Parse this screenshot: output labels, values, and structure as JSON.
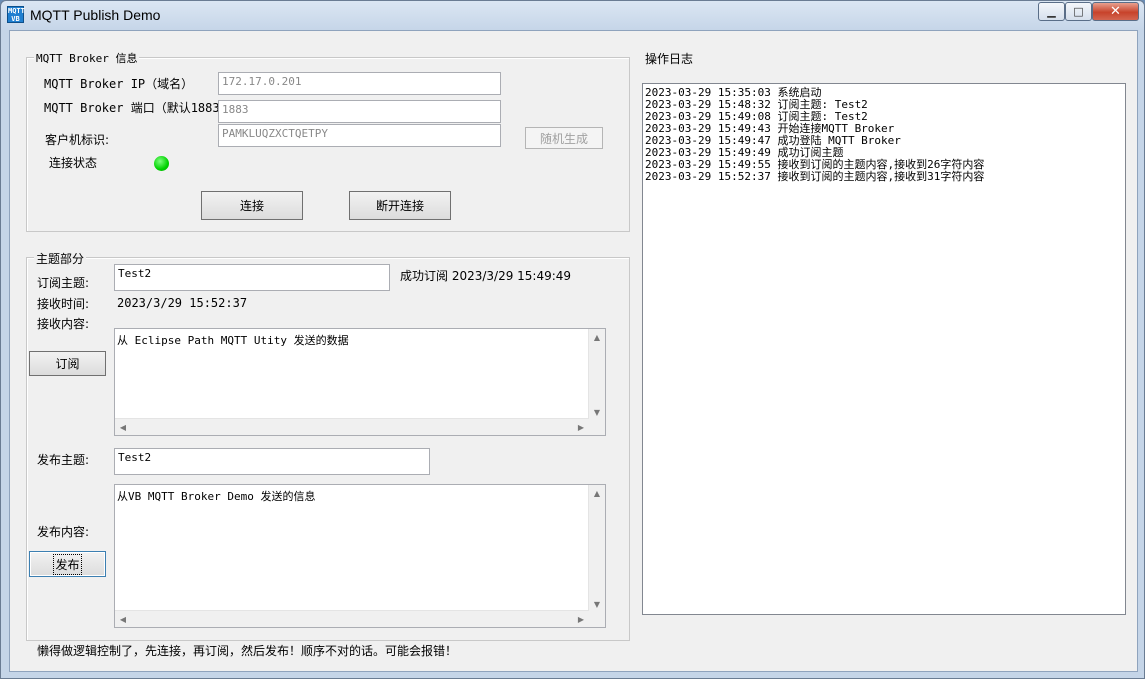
{
  "window": {
    "title": "MQTT Publish Demo",
    "icon_text": "MQTT VB",
    "min_icon": "minimize-icon",
    "max_icon": "maximize-icon",
    "close_icon": "close-icon"
  },
  "broker": {
    "group_label": "MQTT Broker 信息",
    "ip_label": "MQTT Broker IP（域名）",
    "ip_value": "172.17.0.201",
    "port_label": "MQTT Broker 端口（默认1883）",
    "port_value": "1883",
    "client_id_label": "客户机标识:",
    "client_id_value": "PAMKLUQZXCTQETPY",
    "random_button": "随机生成",
    "status_label": "连接状态",
    "status_color": "#00d200",
    "connect_button": "连接",
    "disconnect_button": "断开连接"
  },
  "topic": {
    "group_label": "主题部分",
    "subscribe_topic_label": "订阅主题:",
    "subscribe_topic_value": "Test2",
    "subscribe_status": "成功订阅 2023/3/29 15:49:49",
    "receive_time_label": "接收时间:",
    "receive_time_value": "2023/3/29 15:52:37",
    "receive_content_label": "接收内容:",
    "receive_content_value": "从 Eclipse Path MQTT Utity 发送的数据",
    "subscribe_button": "订阅",
    "publish_topic_label": "发布主题:",
    "publish_topic_value": "Test2",
    "publish_content_label": "发布内容:",
    "publish_content_value": "从VB MQTT Broker Demo 发送的信息",
    "publish_button": "发布"
  },
  "hint": "懒得做逻辑控制了，先连接，再订阅，然后发布！顺序不对的话。可能会报错！",
  "log": {
    "title": "操作日志",
    "lines": [
      "2023-03-29 15:35:03 系统启动",
      "2023-03-29 15:48:32 订阅主题: Test2",
      "2023-03-29 15:49:08 订阅主题: Test2",
      "2023-03-29 15:49:43 开始连接MQTT Broker",
      "2023-03-29 15:49:47 成功登陆 MQTT Broker",
      "2023-03-29 15:49:49 成功订阅主题",
      "2023-03-29 15:49:55 接收到订阅的主题内容,接收到26字符内容",
      "2023-03-29 15:52:37 接收到订阅的主题内容,接收到31字符内容"
    ]
  }
}
